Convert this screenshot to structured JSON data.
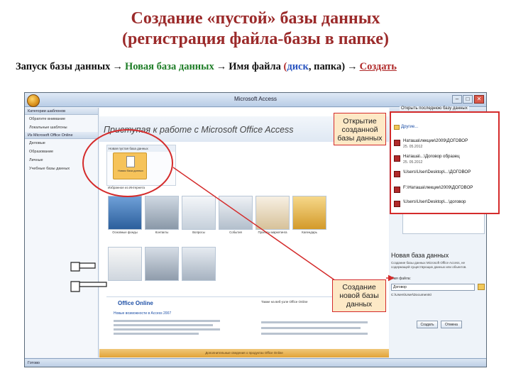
{
  "slide": {
    "title_line1": "Создание «пустой» базы данных",
    "title_line2": "(регистрация файла-базы в папке)"
  },
  "steps": {
    "step1": "Запуск базы данных",
    "step2": "Новая база данных",
    "step3": "Имя файла",
    "paren_open": "(",
    "disk": "диск",
    "comma": ", ",
    "folder": "папка",
    "paren_close": ")",
    "step4": "Создать",
    "arrow": "→"
  },
  "window": {
    "title": "Microsoft Access",
    "minimize": "–",
    "maximize": "□",
    "close": "✕",
    "status": "Готово"
  },
  "sidebar": {
    "header": "Категории шаблонов",
    "items": [
      "Обратите внимание",
      "Локальные шаблоны"
    ],
    "online_header": "Из Microsoft Office Online",
    "online_items": [
      "Деловые",
      "Образование",
      "Личные",
      "Учебные базы данных"
    ]
  },
  "main": {
    "getting_started": "Приступая к работе с Microsoft Office Access",
    "new_blank_header": "Новая пустая база данных",
    "new_blank_label": "Новая база данных",
    "templates_header": "Избранное из Интернета",
    "templates": [
      "Основные фонды",
      "Контакты",
      "Вопросы",
      "События",
      "Проекты маркетинга",
      "Календарь"
    ],
    "online_logo": "Office Online",
    "online_news": "Новые возможности в Access 2007",
    "online_links_header": "Также на веб-узле Office Online",
    "bottom_band": "Дополнительные сведения о продуктах Office Online"
  },
  "recent": {
    "header": "Открыть последнюю базу данных",
    "more": "Другие...",
    "items": [
      {
        "path": "Наташа\\лекции\\2009\\ДОГОВОР",
        "date": "25. 05.2012"
      },
      {
        "path": "Наташа\\...\\Договор образец",
        "date": "25. 05.2012"
      },
      {
        "path": "\\Users\\User\\Desktop\\...\\ДОГОВОР",
        "date": ""
      },
      {
        "path": "F:\\Наташа\\лекции\\2009\\ДОГОВОР",
        "date": ""
      },
      {
        "path": "\\Users\\User\\Desktop\\...\\договор",
        "date": ""
      }
    ]
  },
  "new_db": {
    "title": "Новая база данных",
    "description": "Создание базы данных Microsoft Office Access, не содержащей существующих данных или объектов.",
    "filename_label": "Имя файла:",
    "filename_value": "Договор",
    "path": "C:\\Users\\User\\Documents\\",
    "create_button": "Создать",
    "cancel_button": "Отмена"
  },
  "callouts": {
    "open": "Открытие созданной базы данных",
    "create": "Создание новой базы данных"
  },
  "colors": {
    "title": "#9b2a2a",
    "accent_red": "#d42b2b",
    "callout_bg": "#fde9c6",
    "green": "#1e7d27"
  }
}
